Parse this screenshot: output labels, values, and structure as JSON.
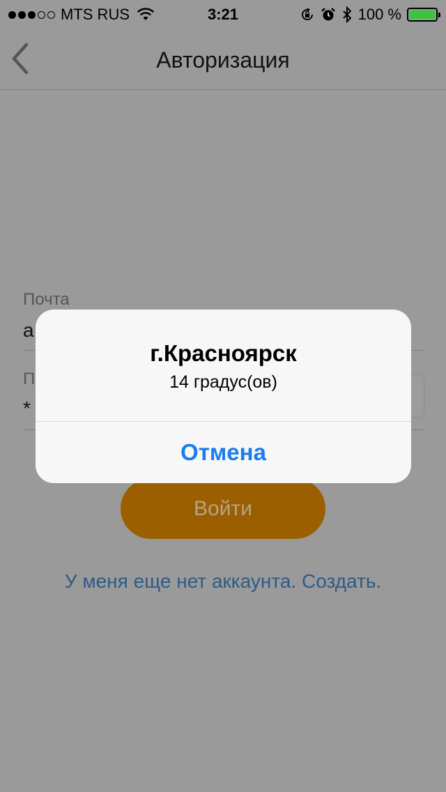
{
  "status_bar": {
    "carrier": "MTS RUS",
    "time": "3:21",
    "battery_text": "100 %",
    "signal_bars_filled": 3,
    "signal_bars_total": 5,
    "battery_level": 1.0,
    "battery_color": "#3cc43c"
  },
  "nav": {
    "title": "Авторизация",
    "back_icon": "chevron-left-icon"
  },
  "form": {
    "email_label": "Почта",
    "email_value": "a",
    "password_label": "П",
    "password_value": "*"
  },
  "login_button": {
    "label": "Войти",
    "color": "#9b5f00"
  },
  "signup_link": {
    "text": "У меня еще нет аккаунта. Создать."
  },
  "alert": {
    "title": "г.Красноярск",
    "message": "14 градус(ов)",
    "cancel_label": "Отмена",
    "button_color": "#1a7cf0"
  }
}
